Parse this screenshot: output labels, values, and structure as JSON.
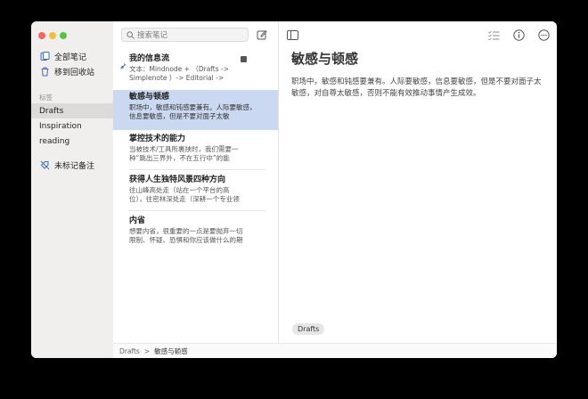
{
  "sidebar": {
    "all_notes": "全部笔记",
    "trash": "移到回收站",
    "tags_header": "标签",
    "tags": [
      "Drafts",
      "Inspiration",
      "reading"
    ],
    "untagged": "未标记备注"
  },
  "list": {
    "search_placeholder": "搜索笔记",
    "notes": [
      {
        "title": "我的信息流",
        "body": "文本：Mindnode + （Drafts ->\nSimplenote ）-> Editorial ->",
        "pinned": true
      },
      {
        "title": "敏感与顿感",
        "body": "职场中，敏感和钝感要兼有。人际要敏感，\n信息要敏感，但是不要对面子太敏",
        "pinned": false
      },
      {
        "title": "掌控技术的能力",
        "body": "当被技术/工具所裹挟时，我们需要一\n种“跳出三界外，不在五行中”的能",
        "pinned": false
      },
      {
        "title": "获得人生独特风景四种方向",
        "body": "往山峰高处走（站在一个平台的高\n位），往密林深处走（深耕一个专业领",
        "pinned": false
      },
      {
        "title": "内省",
        "body": "想要内省，很重要的一点是要抛弃一切\n限制、怀疑、恐惧和你应该做什么的期",
        "pinned": false
      }
    ]
  },
  "editor": {
    "title": "敏感与顿感",
    "body": "职场中，敏感和钝感要兼有。人际要敏感，信息要敏感，但是不要对面子太敏感，对自尊太敏感，否则不能有效推动事情产生成效。",
    "tag_chip": "Drafts"
  },
  "status": {
    "crumb_parent": "Drafts",
    "crumb_sep": ">",
    "crumb_current": "敏感与顿感"
  },
  "colors": {
    "selection": "#cad9f1",
    "sidebar_bg": "#f0efee",
    "accent_blue": "#3f6fb5"
  }
}
